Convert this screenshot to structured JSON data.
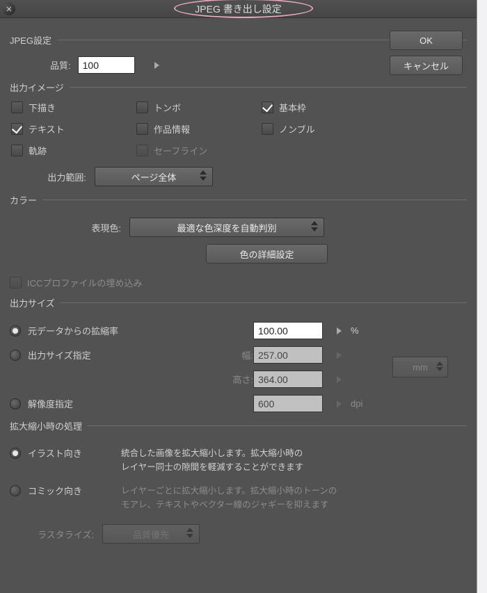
{
  "dialog": {
    "title": "JPEG 書き出し設定",
    "close_glyph": "✕"
  },
  "buttons": {
    "ok": "OK",
    "cancel": "キャンセル"
  },
  "jpeg": {
    "legend": "JPEG設定",
    "quality_label": "品質:",
    "quality_value": "100"
  },
  "output_image": {
    "legend": "出力イメージ",
    "draft": "下描き",
    "crop": "トンボ",
    "basic_frame": "基本枠",
    "text": "テキスト",
    "work_info": "作品情報",
    "nombre": "ノンブル",
    "tracks": "軌跡",
    "safe_line": "セーフライン",
    "range_label": "出力範囲:",
    "range_value": "ページ全体"
  },
  "color": {
    "legend": "カラー",
    "mode_label": "表現色:",
    "mode_value": "最適な色深度を自動判別",
    "detail_button": "色の詳細設定",
    "icc": "ICCプロファイルの埋め込み"
  },
  "size": {
    "legend": "出力サイズ",
    "r_ratio": "元データからの拡縮率",
    "ratio_value": "100.00",
    "percent": "%",
    "r_dim": "出力サイズ指定",
    "width_label": "幅:",
    "width_value": "257.00",
    "height_label": "高さ:",
    "height_value": "364.00",
    "unit": "mm",
    "r_res": "解像度指定",
    "res_value": "600",
    "dpi": "dpi"
  },
  "scale": {
    "legend": "拡大縮小時の処理",
    "r_illust": "イラスト向き",
    "illust_desc": "統合した画像を拡大縮小します。拡大縮小時の\nレイヤー同士の隙間を軽減することができます",
    "r_comic": "コミック向き",
    "comic_desc": "レイヤーごとに拡大縮小します。拡大縮小時のトーンの\nモアレ、テキストやベクター線のジャギーを抑えます",
    "raster_label": "ラスタライズ:",
    "raster_value": "品質優先"
  }
}
